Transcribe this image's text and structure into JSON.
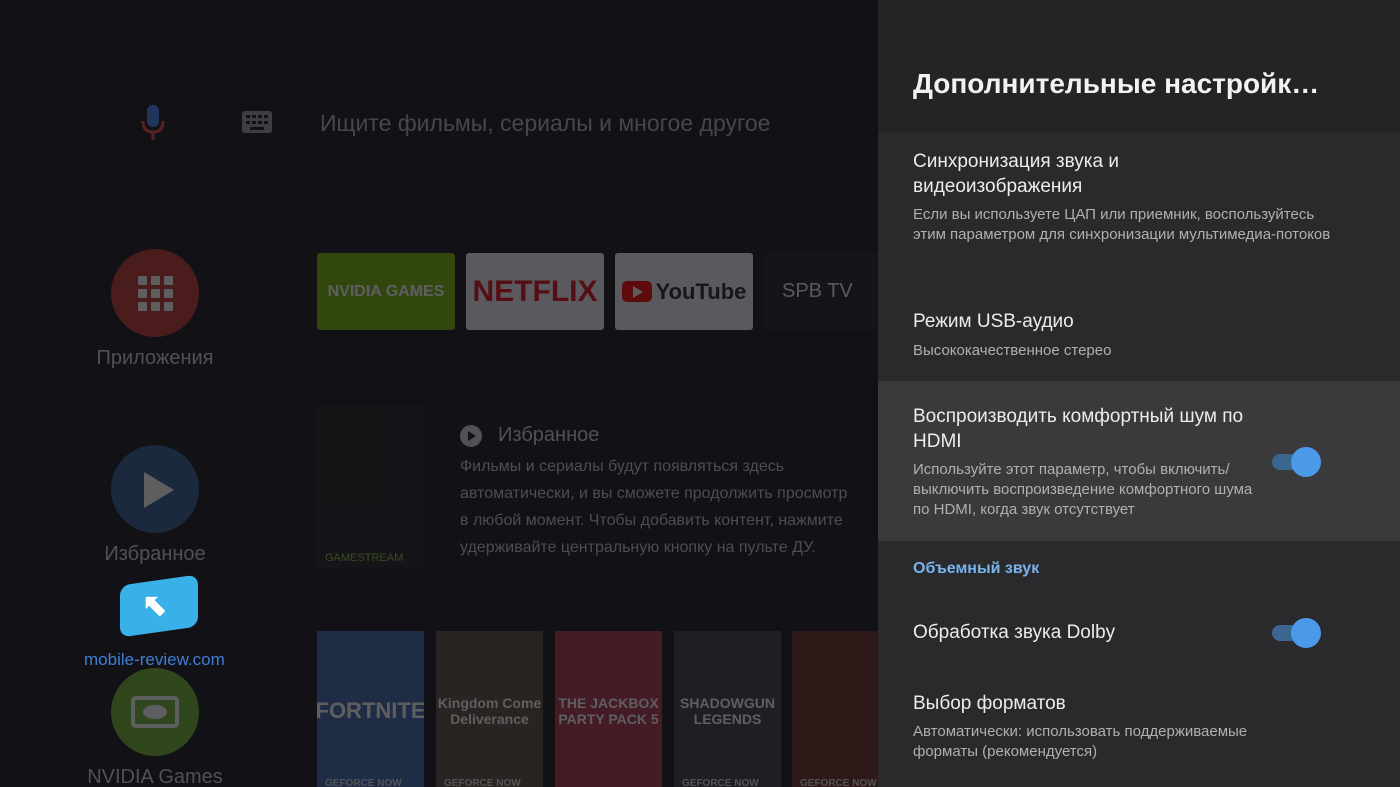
{
  "background": {
    "search_placeholder": "Ищите фильмы, сериалы и многое другое",
    "sidebar": [
      {
        "label": "Приложения",
        "icon": "apps-grid-icon"
      },
      {
        "label": "Избранное",
        "icon": "play-icon"
      },
      {
        "label": "NVIDIA Games",
        "icon": "nvidia-icon"
      }
    ],
    "app_tiles": [
      {
        "label": "NVIDIA GAMES"
      },
      {
        "label": "NETFLIX"
      },
      {
        "label": "YouTube"
      },
      {
        "label": "SPB TV"
      }
    ],
    "gamestream_label": "GAMESTREAM",
    "favorites": {
      "title": "Избранное",
      "description": [
        "Фильмы и сериалы будут появляться здесь",
        "автоматически, и вы сможете продолжить просмотр",
        "в любой момент. Чтобы добавить контент, нажмите",
        "удерживайте центральную кнопку на пульте ДУ."
      ]
    },
    "games": [
      {
        "title": "FORTNITE",
        "badge": "GEFORCE NOW"
      },
      {
        "title": "Kingdom Come Deliverance",
        "badge": "GEFORCE NOW"
      },
      {
        "title": "THE JACKBOX PARTY PACK 5",
        "badge": ""
      },
      {
        "title": "SHADOWGUN LEGENDS",
        "badge": "GEFORCE NOW"
      },
      {
        "title": "",
        "badge": "GEFORCE NOW"
      }
    ],
    "watermark": "mobile-review.com"
  },
  "panel": {
    "title": "Дополнительные настройк…",
    "items": [
      {
        "title": "Синхронизация звука и видеоизображения",
        "subtitle": "Если вы используете ЦАП или приемник, воспользуйтесь этим параметром для синхронизации мультимедиа-потоков"
      },
      {
        "title": "Режим USB-аудио",
        "subtitle": "Высококачественное стерео"
      },
      {
        "title": "Воспроизводить комфортный шум по HDMI",
        "subtitle": "Используйте этот параметр, чтобы включить/ выключить воспроизведение комфортного шума по HDMI, когда звук отсутствует",
        "toggle_on": true
      },
      {
        "title": "Обработка звука Dolby",
        "toggle_on": true
      },
      {
        "title": "Выбор форматов",
        "subtitle": "Автоматически: использовать поддерживаемые форматы (рекомендуется)"
      }
    ],
    "section_header": "Объемный звук"
  },
  "colors": {
    "panel_bg": "#2a2a2c",
    "focused_bg": "#3a3a3d",
    "accent": "#4a9ae9",
    "section_header": "#7ab4ee"
  }
}
